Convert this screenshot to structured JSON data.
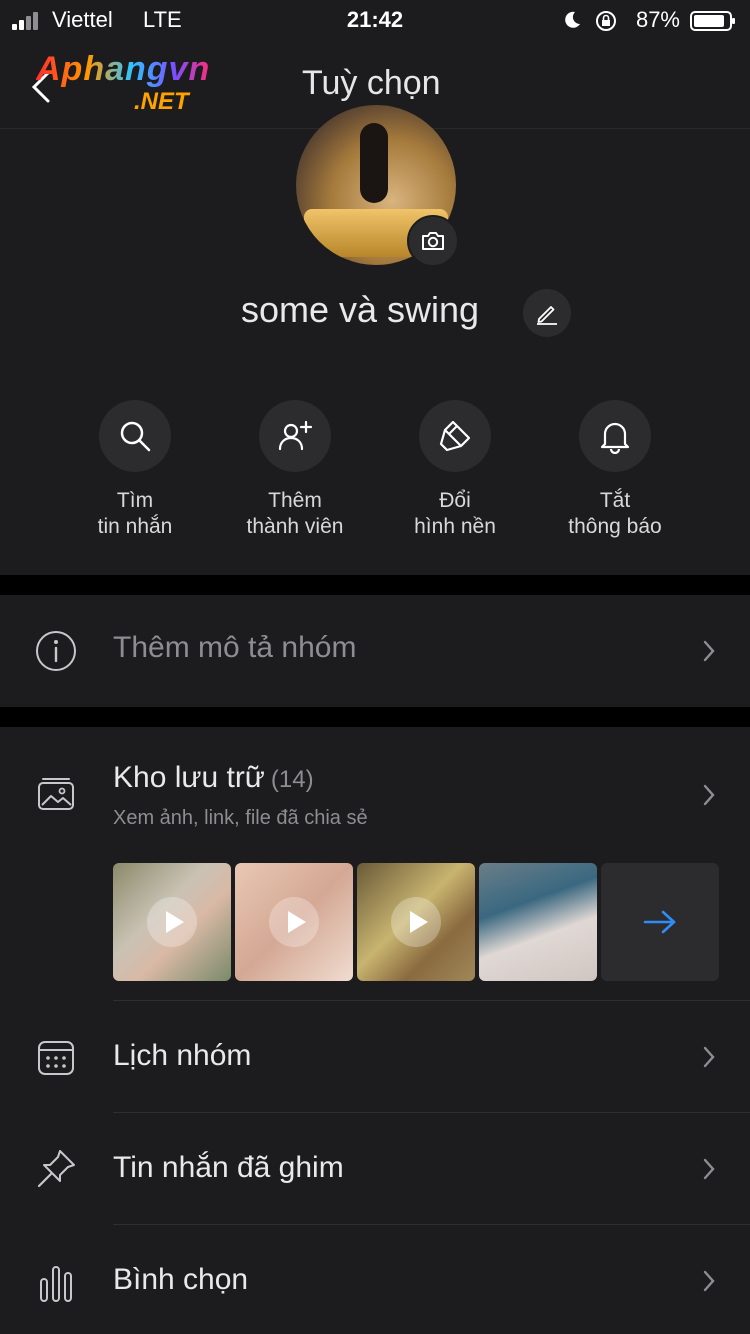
{
  "status_bar": {
    "carrier": "Viettel",
    "network": "LTE",
    "time": "21:42",
    "battery": "87%"
  },
  "header": {
    "logo_main": "Aphangvn",
    "logo_sub": ".NET",
    "title": "Tuỳ chọn"
  },
  "profile": {
    "group_name": "some và swing",
    "actions": [
      {
        "line1": "Tìm",
        "line2": "tin nhắn",
        "icon": "search-icon"
      },
      {
        "line1": "Thêm",
        "line2": "thành viên",
        "icon": "add-member-icon"
      },
      {
        "line1": "Đổi",
        "line2": "hình nền",
        "icon": "paint-brush-icon"
      },
      {
        "line1": "Tắt",
        "line2": "thông báo",
        "icon": "bell-icon"
      }
    ]
  },
  "description": {
    "label": "Thêm mô tả nhóm"
  },
  "storage": {
    "title": "Kho lưu trữ",
    "count": "(14)",
    "subtitle": "Xem ảnh, link, file đã chia sẻ"
  },
  "menu": {
    "calendar": "Lịch nhóm",
    "pinned": "Tin nhắn đã ghim",
    "poll": "Bình chọn"
  },
  "colors": {
    "background": "#1c1c1e",
    "accent_arrow": "#2f8df5"
  }
}
